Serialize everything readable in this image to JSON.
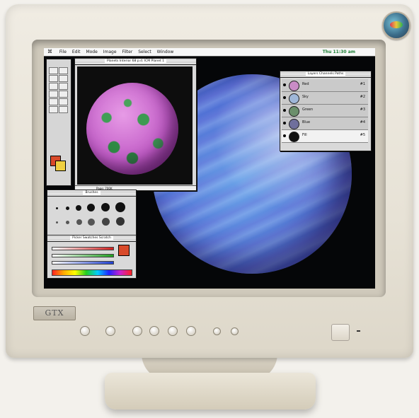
{
  "menubar": {
    "apple": "⌘",
    "items": [
      "File",
      "Edit",
      "Mode",
      "Image",
      "Filter",
      "Select",
      "Window"
    ],
    "clock": "Thu 11:30 am"
  },
  "planet_window": {
    "title": "Planets Interior 68 p.d. ICM Planet 1",
    "status": "Page: 700K"
  },
  "layers_panel": {
    "title": "Layers  Channels  Paths",
    "rows": [
      {
        "name": "Red",
        "num": "#1"
      },
      {
        "name": "Sky",
        "num": "#2"
      },
      {
        "name": "Green",
        "num": "#3"
      },
      {
        "name": "Blue",
        "num": "#4"
      },
      {
        "name": "Fill",
        "num": "#5"
      }
    ]
  },
  "brushes_panel": {
    "title": "Brushes"
  },
  "picker_panel": {
    "title": "Picker  Swatches  Scratch"
  },
  "brand": {
    "label": "GTX"
  },
  "colors": {
    "planet": "#4f6fd4",
    "pink_planet": "#c35ec8",
    "screen_bg": "#050608"
  }
}
